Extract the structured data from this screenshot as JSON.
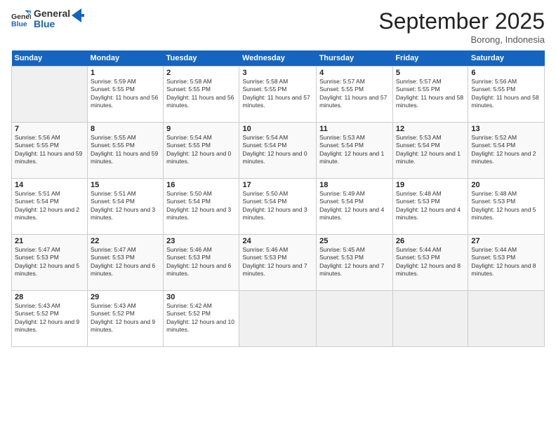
{
  "header": {
    "logo_line1": "General",
    "logo_line2": "Blue",
    "month": "September 2025",
    "location": "Borong, Indonesia"
  },
  "days_of_week": [
    "Sunday",
    "Monday",
    "Tuesday",
    "Wednesday",
    "Thursday",
    "Friday",
    "Saturday"
  ],
  "weeks": [
    [
      {
        "num": "",
        "sunrise": "",
        "sunset": "",
        "daylight": "",
        "empty": true
      },
      {
        "num": "1",
        "sunrise": "Sunrise: 5:59 AM",
        "sunset": "Sunset: 5:55 PM",
        "daylight": "Daylight: 11 hours and 56 minutes."
      },
      {
        "num": "2",
        "sunrise": "Sunrise: 5:58 AM",
        "sunset": "Sunset: 5:55 PM",
        "daylight": "Daylight: 11 hours and 56 minutes."
      },
      {
        "num": "3",
        "sunrise": "Sunrise: 5:58 AM",
        "sunset": "Sunset: 5:55 PM",
        "daylight": "Daylight: 11 hours and 57 minutes."
      },
      {
        "num": "4",
        "sunrise": "Sunrise: 5:57 AM",
        "sunset": "Sunset: 5:55 PM",
        "daylight": "Daylight: 11 hours and 57 minutes."
      },
      {
        "num": "5",
        "sunrise": "Sunrise: 5:57 AM",
        "sunset": "Sunset: 5:55 PM",
        "daylight": "Daylight: 11 hours and 58 minutes."
      },
      {
        "num": "6",
        "sunrise": "Sunrise: 5:56 AM",
        "sunset": "Sunset: 5:55 PM",
        "daylight": "Daylight: 11 hours and 58 minutes."
      }
    ],
    [
      {
        "num": "7",
        "sunrise": "Sunrise: 5:56 AM",
        "sunset": "Sunset: 5:55 PM",
        "daylight": "Daylight: 11 hours and 59 minutes."
      },
      {
        "num": "8",
        "sunrise": "Sunrise: 5:55 AM",
        "sunset": "Sunset: 5:55 PM",
        "daylight": "Daylight: 11 hours and 59 minutes."
      },
      {
        "num": "9",
        "sunrise": "Sunrise: 5:54 AM",
        "sunset": "Sunset: 5:55 PM",
        "daylight": "Daylight: 12 hours and 0 minutes."
      },
      {
        "num": "10",
        "sunrise": "Sunrise: 5:54 AM",
        "sunset": "Sunset: 5:54 PM",
        "daylight": "Daylight: 12 hours and 0 minutes."
      },
      {
        "num": "11",
        "sunrise": "Sunrise: 5:53 AM",
        "sunset": "Sunset: 5:54 PM",
        "daylight": "Daylight: 12 hours and 1 minute."
      },
      {
        "num": "12",
        "sunrise": "Sunrise: 5:53 AM",
        "sunset": "Sunset: 5:54 PM",
        "daylight": "Daylight: 12 hours and 1 minute."
      },
      {
        "num": "13",
        "sunrise": "Sunrise: 5:52 AM",
        "sunset": "Sunset: 5:54 PM",
        "daylight": "Daylight: 12 hours and 2 minutes."
      }
    ],
    [
      {
        "num": "14",
        "sunrise": "Sunrise: 5:51 AM",
        "sunset": "Sunset: 5:54 PM",
        "daylight": "Daylight: 12 hours and 2 minutes."
      },
      {
        "num": "15",
        "sunrise": "Sunrise: 5:51 AM",
        "sunset": "Sunset: 5:54 PM",
        "daylight": "Daylight: 12 hours and 3 minutes."
      },
      {
        "num": "16",
        "sunrise": "Sunrise: 5:50 AM",
        "sunset": "Sunset: 5:54 PM",
        "daylight": "Daylight: 12 hours and 3 minutes."
      },
      {
        "num": "17",
        "sunrise": "Sunrise: 5:50 AM",
        "sunset": "Sunset: 5:54 PM",
        "daylight": "Daylight: 12 hours and 3 minutes."
      },
      {
        "num": "18",
        "sunrise": "Sunrise: 5:49 AM",
        "sunset": "Sunset: 5:54 PM",
        "daylight": "Daylight: 12 hours and 4 minutes."
      },
      {
        "num": "19",
        "sunrise": "Sunrise: 5:48 AM",
        "sunset": "Sunset: 5:53 PM",
        "daylight": "Daylight: 12 hours and 4 minutes."
      },
      {
        "num": "20",
        "sunrise": "Sunrise: 5:48 AM",
        "sunset": "Sunset: 5:53 PM",
        "daylight": "Daylight: 12 hours and 5 minutes."
      }
    ],
    [
      {
        "num": "21",
        "sunrise": "Sunrise: 5:47 AM",
        "sunset": "Sunset: 5:53 PM",
        "daylight": "Daylight: 12 hours and 5 minutes."
      },
      {
        "num": "22",
        "sunrise": "Sunrise: 5:47 AM",
        "sunset": "Sunset: 5:53 PM",
        "daylight": "Daylight: 12 hours and 6 minutes."
      },
      {
        "num": "23",
        "sunrise": "Sunrise: 5:46 AM",
        "sunset": "Sunset: 5:53 PM",
        "daylight": "Daylight: 12 hours and 6 minutes."
      },
      {
        "num": "24",
        "sunrise": "Sunrise: 5:46 AM",
        "sunset": "Sunset: 5:53 PM",
        "daylight": "Daylight: 12 hours and 7 minutes."
      },
      {
        "num": "25",
        "sunrise": "Sunrise: 5:45 AM",
        "sunset": "Sunset: 5:53 PM",
        "daylight": "Daylight: 12 hours and 7 minutes."
      },
      {
        "num": "26",
        "sunrise": "Sunrise: 5:44 AM",
        "sunset": "Sunset: 5:53 PM",
        "daylight": "Daylight: 12 hours and 8 minutes."
      },
      {
        "num": "27",
        "sunrise": "Sunrise: 5:44 AM",
        "sunset": "Sunset: 5:53 PM",
        "daylight": "Daylight: 12 hours and 8 minutes."
      }
    ],
    [
      {
        "num": "28",
        "sunrise": "Sunrise: 5:43 AM",
        "sunset": "Sunset: 5:52 PM",
        "daylight": "Daylight: 12 hours and 9 minutes."
      },
      {
        "num": "29",
        "sunrise": "Sunrise: 5:43 AM",
        "sunset": "Sunset: 5:52 PM",
        "daylight": "Daylight: 12 hours and 9 minutes."
      },
      {
        "num": "30",
        "sunrise": "Sunrise: 5:42 AM",
        "sunset": "Sunset: 5:52 PM",
        "daylight": "Daylight: 12 hours and 10 minutes."
      },
      {
        "num": "",
        "sunrise": "",
        "sunset": "",
        "daylight": "",
        "empty": true
      },
      {
        "num": "",
        "sunrise": "",
        "sunset": "",
        "daylight": "",
        "empty": true
      },
      {
        "num": "",
        "sunrise": "",
        "sunset": "",
        "daylight": "",
        "empty": true
      },
      {
        "num": "",
        "sunrise": "",
        "sunset": "",
        "daylight": "",
        "empty": true
      }
    ]
  ]
}
